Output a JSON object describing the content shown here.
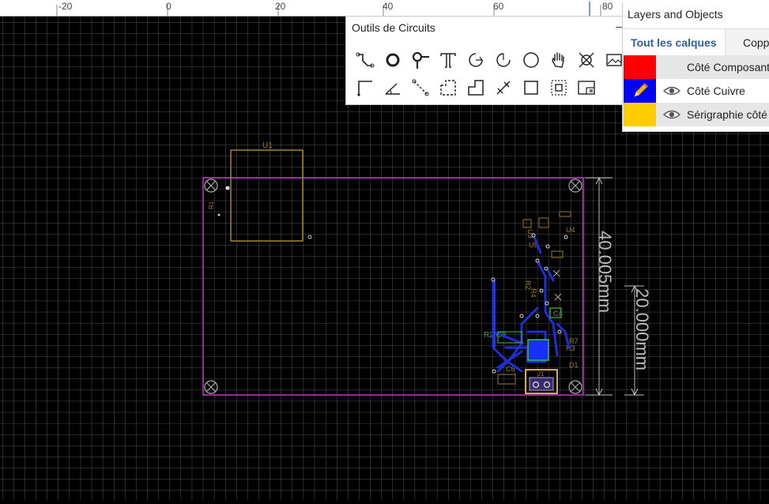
{
  "ruler": {
    "labels": [
      "-20",
      "0",
      "20",
      "40",
      "60",
      "80"
    ]
  },
  "tools_panel": {
    "title": "Outils de Circuits",
    "collapse_label": "–",
    "tools_row1": [
      "track-icon",
      "via-icon",
      "pin-icon",
      "text-icon",
      "arc-icon",
      "circle-arc-icon",
      "circle-icon",
      "pan-hand-icon",
      "connect-icon",
      "image-icon"
    ],
    "tools_row2": [
      "corner-icon",
      "angle-icon",
      "dimension-line-icon",
      "copper-area-icon",
      "outline-icon",
      "cut-icon",
      "rectangle-icon",
      "group-icon",
      "board-icon"
    ]
  },
  "layers_panel": {
    "title": "Layers and Objects",
    "tabs": [
      "Tout les calques",
      "Copp"
    ],
    "layers": [
      {
        "name": "Côté Composant",
        "color": "#ff0000",
        "row_bg": "#e6e6e6"
      },
      {
        "name": "Côté Cuivre",
        "color": "#0000ff",
        "row_bg": "#ffffff"
      },
      {
        "name": "Sérigraphie côté",
        "color": "#ffcc00",
        "row_bg": "#e6e6e6"
      }
    ]
  },
  "pcb": {
    "component_labels": [
      "U1",
      "U3",
      "U4",
      "U5",
      "R2",
      "R3",
      "R4",
      "R7",
      "C4",
      "C6",
      "D1"
    ],
    "dimension_horizontal": "40.005mm",
    "dimension_vertical": "20.000mm",
    "connector_label": "J1"
  }
}
